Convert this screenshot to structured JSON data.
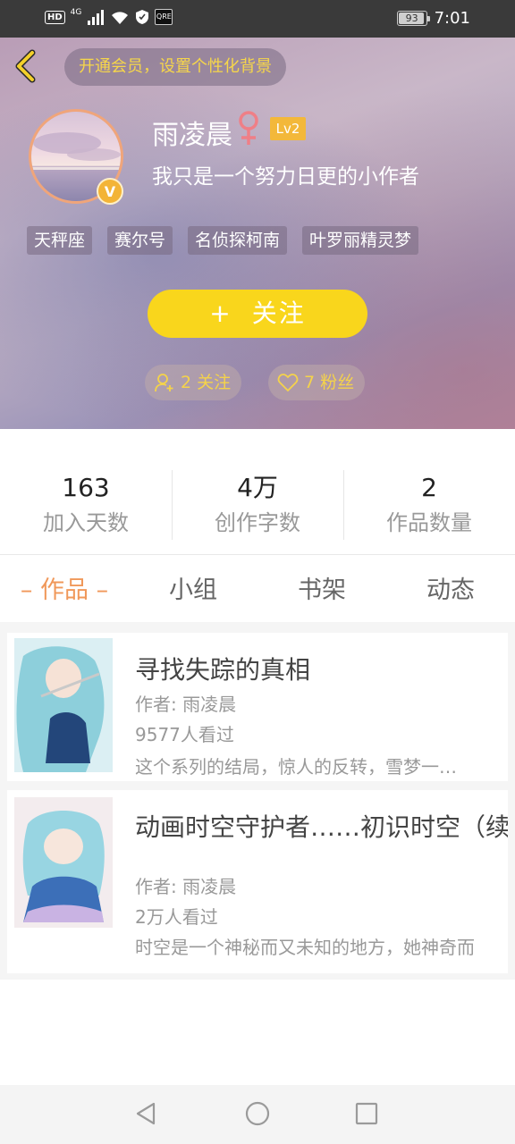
{
  "status_bar": {
    "hd": "HD",
    "network": "4G",
    "app_icon_label": "QRE",
    "battery": "93",
    "battery_fraction": 0.93,
    "time": "7:01"
  },
  "header": {
    "vip_banner": "开通会员，设置个性化背景",
    "user_name": "雨凌晨",
    "gender_symbol": "♀",
    "level": "Lv2",
    "avatar_badge": "V",
    "bio": "我只是一个努力日更的小作者",
    "tags": [
      "天秤座",
      "赛尔号",
      "名侦探柯南",
      "叶罗丽精灵梦"
    ],
    "follow_plus": "+",
    "follow_button": "关注",
    "following_pill": "2 关注",
    "fans_pill": "7 粉丝"
  },
  "stats": [
    {
      "value": "163",
      "label": "加入天数"
    },
    {
      "value": "4万",
      "label": "创作字数"
    },
    {
      "value": "2",
      "label": "作品数量"
    }
  ],
  "tabs": [
    {
      "label": "– 作品 –",
      "active": true
    },
    {
      "label": "小组",
      "active": false
    },
    {
      "label": "书架",
      "active": false
    },
    {
      "label": "动态",
      "active": false
    }
  ],
  "works": [
    {
      "title": "寻找失踪的真相",
      "author": "作者: 雨凌晨",
      "views": "9577人看过",
      "description": "这个系列的结局，惊人的反转，雪梦一…"
    },
    {
      "title": "动画时空守护者……初识时空（续",
      "author": "作者: 雨凌晨",
      "views": "2万人看过",
      "description": "时空是一个神秘而又未知的地方，她神奇而"
    }
  ],
  "colors": {
    "accent_yellow": "#f9d61c",
    "active_tab": "#f0985a",
    "level_badge": "#f3b83a",
    "banner_text": "#f6d64a"
  },
  "icons": {
    "back": "chevron-left-icon",
    "gender": "female-icon",
    "following": "user-add-icon",
    "fans": "heart-icon",
    "nav": [
      "back-triangle-icon",
      "home-circle-icon",
      "recent-square-icon"
    ]
  }
}
